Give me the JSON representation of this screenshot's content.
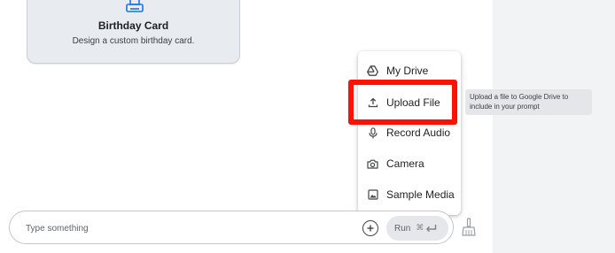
{
  "card": {
    "title": "Birthday Card",
    "description": "Design a custom birthday card.",
    "icon": "printer-icon"
  },
  "menu": {
    "items": [
      {
        "label": "My Drive",
        "icon": "google-drive-icon"
      },
      {
        "label": "Upload File",
        "icon": "upload-icon",
        "highlighted": true
      },
      {
        "label": "Record Audio",
        "icon": "microphone-icon"
      },
      {
        "label": "Camera",
        "icon": "camera-icon"
      },
      {
        "label": "Sample Media",
        "icon": "image-icon"
      }
    ]
  },
  "tooltip": {
    "text": "Upload a file to Google Drive to include in your prompt"
  },
  "prompt": {
    "placeholder": "Type something",
    "add_icon": "plus-circle-icon",
    "run_label": "Run",
    "run_shortcut": "⌘",
    "enter_icon": "enter-icon",
    "clean_icon": "broom-icon"
  },
  "colors": {
    "highlight": "#ff1100",
    "card_bg": "#e8ecf1",
    "tooltip_bg": "#e4e6e9",
    "run_bg": "#e5e7ea"
  }
}
